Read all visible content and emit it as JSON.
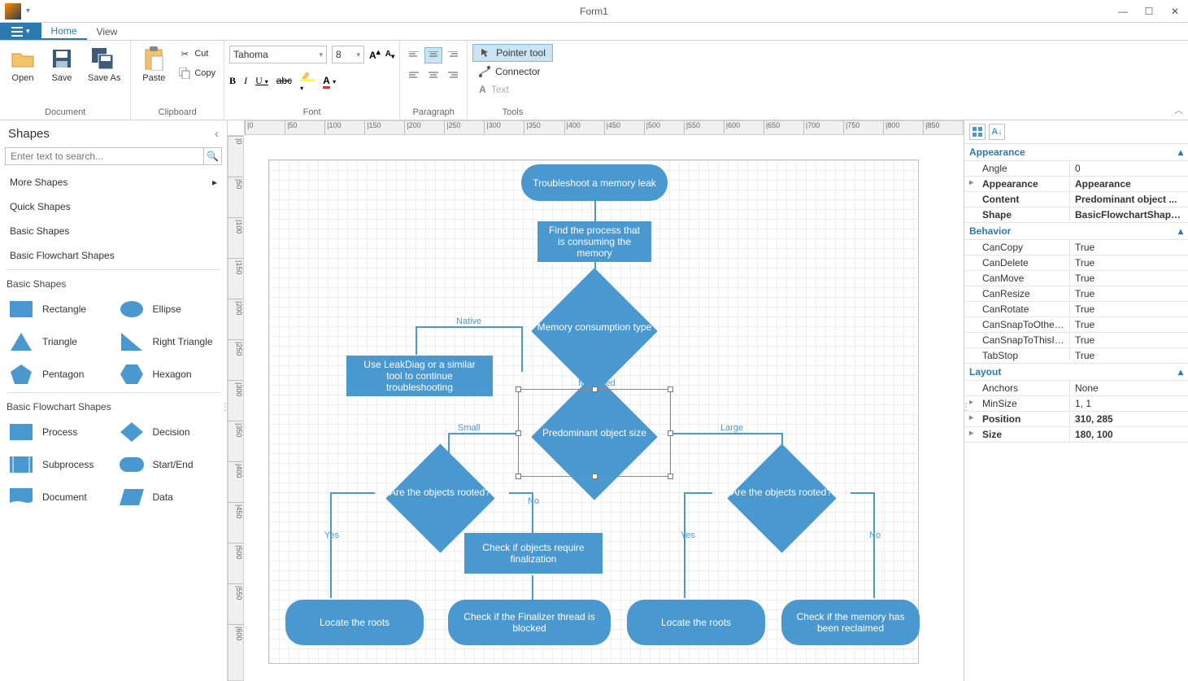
{
  "window": {
    "title": "Form1"
  },
  "tabs": {
    "home": "Home",
    "view": "View"
  },
  "ribbon": {
    "document": {
      "label": "Document",
      "open": "Open",
      "save": "Save",
      "saveas": "Save As"
    },
    "clipboard": {
      "label": "Clipboard",
      "paste": "Paste",
      "cut": "Cut",
      "copy": "Copy"
    },
    "font": {
      "label": "Font",
      "family": "Tahoma",
      "size": "8"
    },
    "paragraph": {
      "label": "Paragraph"
    },
    "tools": {
      "label": "Tools",
      "pointer": "Pointer tool",
      "connector": "Connector",
      "text": "Text"
    }
  },
  "shapes_panel": {
    "title": "Shapes",
    "search_placeholder": "Enter text to search...",
    "nav": {
      "more": "More Shapes",
      "quick": "Quick Shapes",
      "basic": "Basic Shapes",
      "flow": "Basic Flowchart Shapes"
    },
    "cat_basic": "Basic Shapes",
    "cat_flow": "Basic Flowchart Shapes",
    "basic": {
      "rectangle": "Rectangle",
      "ellipse": "Ellipse",
      "triangle": "Triangle",
      "right_triangle": "Right Triangle",
      "pentagon": "Pentagon",
      "hexagon": "Hexagon"
    },
    "flow": {
      "process": "Process",
      "decision": "Decision",
      "subprocess": "Subprocess",
      "startend": "Start/End",
      "document": "Document",
      "data": "Data"
    }
  },
  "ruler_h": [
    "|0",
    "|50",
    "|100",
    "|150",
    "|200",
    "|250",
    "|300",
    "|350",
    "|400",
    "|450",
    "|500",
    "|550",
    "|600",
    "|650",
    "|700",
    "|750",
    "|800",
    "|850"
  ],
  "ruler_v": [
    "|0",
    "|50",
    "|100",
    "|150",
    "|200",
    "|250",
    "|300",
    "|350",
    "|400",
    "|450",
    "|500",
    "|550",
    "|600"
  ],
  "flowchart": {
    "n1": "Troubleshoot a memory leak",
    "n2": "Find the process that is consuming the memory",
    "n3": "Memory consumption type",
    "n4": "Use LeakDiag or a similar tool to continue troubleshooting",
    "n5": "Predominant object size",
    "n6": "Are the objects rooted?",
    "n7": "Are the objects rooted?",
    "n8": "Check if objects require finalization",
    "n9": "Locate the roots",
    "n10": "Check if the Finalizer thread is blocked",
    "n11": "Locate the roots",
    "n12": "Check if the memory has been reclaimed",
    "l_native": "Native",
    "l_managed": "Managed",
    "l_small": "Small",
    "l_large": "Large",
    "l_yes": "Yes",
    "l_no": "No"
  },
  "props": {
    "cat_appearance": "Appearance",
    "cat_behavior": "Behavior",
    "cat_layout": "Layout",
    "rows": {
      "angle_k": "Angle",
      "angle_v": "0",
      "appearance_k": "Appearance",
      "appearance_v": "Appearance",
      "content_k": "Content",
      "content_v": "Predominant object ...",
      "shape_k": "Shape",
      "shape_v": "BasicFlowchartShape...",
      "cancopy_k": "CanCopy",
      "cancopy_v": "True",
      "candelete_k": "CanDelete",
      "candelete_v": "True",
      "canmove_k": "CanMove",
      "canmove_v": "True",
      "canresize_k": "CanResize",
      "canresize_v": "True",
      "canrotate_k": "CanRotate",
      "canrotate_v": "True",
      "snapother_k": "CanSnapToOtherItems",
      "snapother_v": "True",
      "snapthis_k": "CanSnapToThisItem",
      "snapthis_v": "True",
      "tabstop_k": "TabStop",
      "tabstop_v": "True",
      "anchors_k": "Anchors",
      "anchors_v": "None",
      "minsize_k": "MinSize",
      "minsize_v": "1, 1",
      "position_k": "Position",
      "position_v": "310, 285",
      "size_k": "Size",
      "size_v": "180, 100"
    }
  }
}
